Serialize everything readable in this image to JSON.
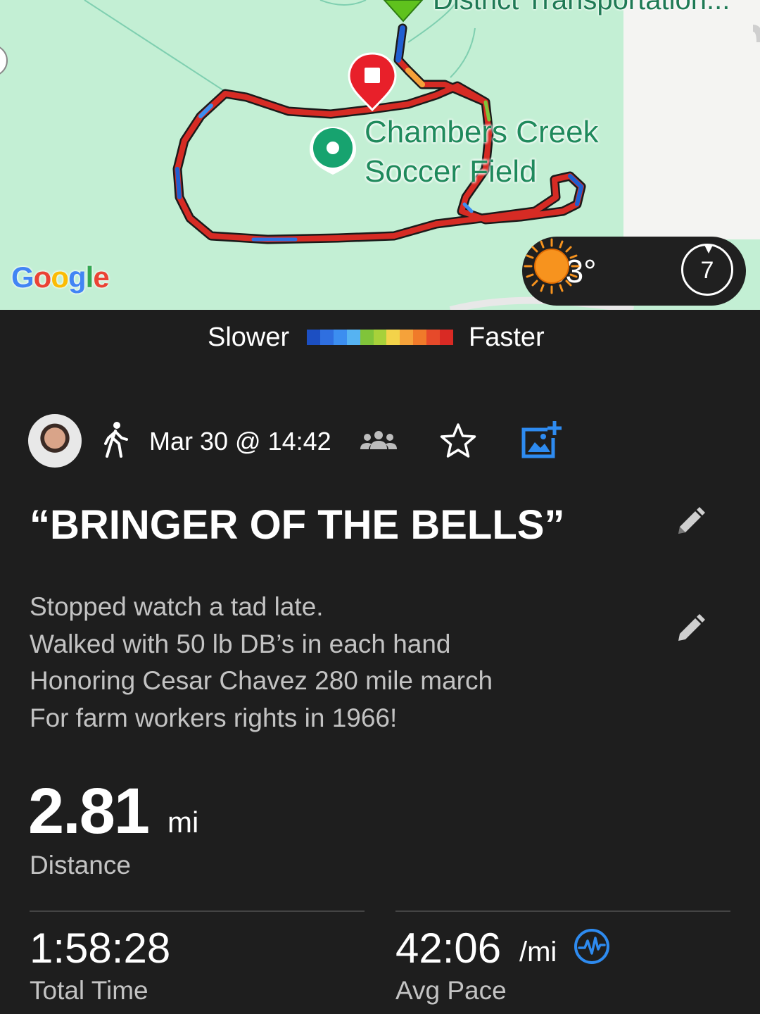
{
  "map": {
    "labels": {
      "district": "District Transportation...",
      "field_line1": "Chambers Creek",
      "field_line2": "Soccer Field"
    },
    "google_logo": {
      "letters": [
        "G",
        "o",
        "o",
        "g",
        "l",
        "e"
      ],
      "colors": [
        "#4285f4",
        "#ea4335",
        "#fbbc05",
        "#4285f4",
        "#34a853",
        "#ea4335"
      ]
    },
    "weather": {
      "temperature": "63°",
      "condition_icon": "sun-icon",
      "wind_speed": "7"
    },
    "colors": {
      "background": "#c3efd4",
      "route_fast": "#d62b24",
      "route_slow": "#1f5fd1",
      "start_pin": "#5fc21d",
      "end_pin": "#e8202a",
      "poi_pin": "#17a36f"
    }
  },
  "legend": {
    "slower_label": "Slower",
    "faster_label": "Faster",
    "gradient_colors": [
      "#1c4fc2",
      "#2f6fe0",
      "#3c8ef0",
      "#56b3f2",
      "#80c43a",
      "#a8d13a",
      "#f3d34a",
      "#f5a23a",
      "#f07a2a",
      "#e64a2a",
      "#d92a24"
    ]
  },
  "activity": {
    "icon": "walk-icon",
    "date": "Mar 30 @ 14:42",
    "privacy_icon": "group-icon",
    "title": "“BRINGER OF THE BELLS”",
    "description_lines": [
      "Stopped watch a tad late.",
      "Walked with 50 lb DB’s in each hand",
      "Honoring Cesar Chavez 280 mile march",
      "For farm workers rights in 1966!"
    ]
  },
  "stats": {
    "distance_value": "2.81",
    "distance_unit": "mi",
    "distance_label": "Distance",
    "time_value": "1:58:28",
    "time_label": "Total Time",
    "pace_value": "42:06",
    "pace_unit": "/mi",
    "pace_label": "Avg Pace"
  },
  "colors": {
    "background": "#1e1e1e",
    "accent_blue": "#2e8bf0",
    "muted_text": "#c3c3c3"
  }
}
